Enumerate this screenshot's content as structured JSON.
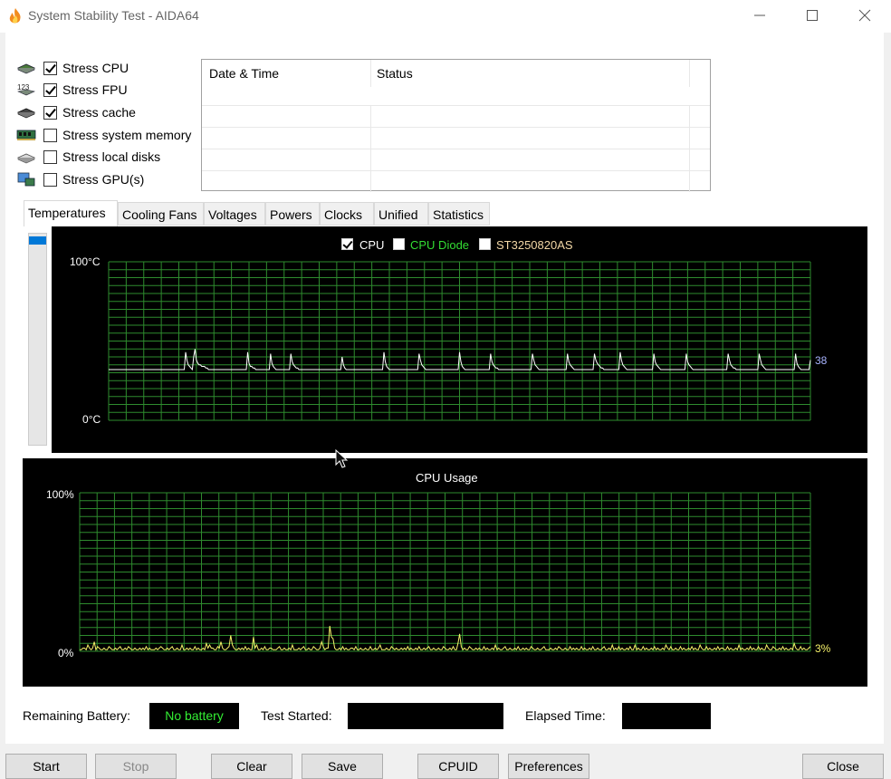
{
  "window": {
    "title": "System Stability Test - AIDA64",
    "controls": {
      "minimize": "—",
      "maximize": "☐",
      "close": "✕"
    }
  },
  "stress_options": [
    {
      "label": "Stress CPU",
      "checked": true,
      "icon": "cpu-chip-icon"
    },
    {
      "label": "Stress FPU",
      "checked": true,
      "icon": "fpu-123-icon"
    },
    {
      "label": "Stress cache",
      "checked": true,
      "icon": "cache-chip-icon"
    },
    {
      "label": "Stress system memory",
      "checked": false,
      "icon": "memory-module-icon"
    },
    {
      "label": "Stress local disks",
      "checked": false,
      "icon": "disk-drive-icon"
    },
    {
      "label": "Stress GPU(s)",
      "checked": false,
      "icon": "gpu-monitor-icon"
    }
  ],
  "log_table": {
    "columns": [
      "Date & Time",
      "Status"
    ],
    "rows": [
      [],
      [],
      [],
      []
    ]
  },
  "tabs": [
    "Temperatures",
    "Cooling Fans",
    "Voltages",
    "Powers",
    "Clocks",
    "Unified",
    "Statistics"
  ],
  "active_tab": "Temperatures",
  "temperature_graph": {
    "legend": [
      {
        "label": "CPU",
        "checked": true,
        "color": "#ffffff"
      },
      {
        "label": "CPU Diode",
        "checked": false,
        "color": "#33dd33"
      },
      {
        "label": "ST3250820AS",
        "checked": false,
        "color": "#f2d7a6"
      }
    ],
    "y_max_label": "100",
    "y_min_label": "0",
    "unit": "°C",
    "current_value": "38",
    "ylim": [
      0,
      100
    ],
    "samples": [
      32,
      32,
      32,
      32,
      32,
      32,
      32,
      32,
      32,
      32,
      32,
      32,
      32,
      32,
      32,
      32,
      32,
      32,
      32,
      32,
      32,
      32,
      32,
      32,
      32,
      32,
      32,
      32,
      32,
      32,
      32,
      32,
      32,
      32,
      32,
      32,
      32,
      32,
      32,
      32,
      32,
      32,
      32,
      32,
      32,
      32,
      32,
      32,
      32,
      32,
      32,
      32,
      32,
      32,
      32,
      32,
      32,
      43,
      38,
      35,
      34,
      33,
      32,
      40,
      45,
      38,
      36,
      35,
      35,
      34,
      34,
      34,
      33,
      33,
      32,
      32,
      32,
      32,
      32,
      32,
      32,
      32,
      32,
      32,
      32,
      32,
      32,
      32,
      32,
      32,
      32,
      32,
      32,
      32,
      32,
      32,
      32,
      32,
      32,
      32,
      32,
      32,
      32,
      43,
      36,
      34,
      34,
      33,
      33,
      32,
      32,
      32,
      32,
      32,
      32,
      32,
      32,
      32,
      32,
      32,
      42,
      36,
      34,
      33,
      32,
      32,
      32,
      32,
      32,
      32,
      32,
      32,
      32,
      32,
      32,
      42,
      37,
      35,
      34,
      33,
      33,
      32,
      32,
      32,
      32,
      32,
      32,
      32,
      32,
      32,
      32,
      32,
      32,
      32,
      32,
      32,
      32,
      32,
      32,
      32,
      32,
      32,
      32,
      32,
      32,
      32,
      32,
      32,
      32,
      32,
      32,
      32,
      32,
      40,
      35,
      33,
      32,
      32,
      32,
      32,
      32,
      32,
      32,
      32,
      32,
      32,
      32,
      32,
      32,
      32,
      32,
      32,
      32,
      32,
      32,
      32,
      32,
      32,
      32,
      32,
      32,
      32,
      32,
      32,
      43,
      37,
      34,
      33,
      32,
      32,
      32,
      32,
      32,
      32,
      32,
      32,
      32,
      32,
      32,
      32,
      32,
      32,
      32,
      32,
      32,
      32,
      32,
      32,
      32,
      32,
      42,
      38,
      35,
      34,
      33,
      32,
      32,
      32,
      32,
      32,
      32,
      32,
      32,
      32,
      32,
      32,
      32,
      32,
      32,
      32,
      32,
      32,
      32,
      32,
      32,
      32,
      32,
      32,
      32,
      32,
      43,
      37,
      34,
      33,
      32,
      32,
      32,
      32,
      32,
      32,
      32,
      32,
      32,
      32,
      32,
      32,
      32,
      32,
      32,
      32,
      32,
      32,
      32,
      42,
      37,
      35,
      34,
      33,
      33,
      32,
      32,
      32,
      32,
      32,
      32,
      32,
      32,
      32,
      32,
      32,
      32,
      32,
      32,
      32,
      32,
      32,
      32,
      32,
      32,
      32,
      32,
      32,
      32,
      32,
      42,
      38,
      35,
      34,
      33,
      32,
      32,
      32,
      32,
      32,
      32,
      32,
      32,
      32,
      32,
      32,
      32,
      32,
      32,
      32,
      32,
      32,
      32,
      32,
      32,
      32,
      42,
      37,
      35,
      34,
      33,
      32,
      32,
      32,
      32,
      32,
      32,
      32,
      32,
      32,
      32,
      32,
      32,
      32,
      32,
      32,
      42,
      38,
      36,
      35,
      34,
      33,
      33,
      32,
      32,
      32,
      32,
      32,
      32,
      32,
      32,
      32,
      32,
      32,
      32,
      43,
      38,
      35,
      34,
      33,
      32,
      32,
      32,
      32,
      32,
      32,
      32,
      32,
      32,
      32,
      32,
      32,
      32,
      32,
      32,
      32,
      32,
      32,
      32,
      32,
      42,
      37,
      35,
      34,
      33,
      32,
      32,
      32,
      32,
      32,
      32,
      32,
      32,
      32,
      32,
      32,
      32,
      32,
      32,
      32,
      32,
      32,
      32,
      32,
      42,
      37,
      35,
      34,
      33,
      32,
      32,
      32,
      32,
      32,
      32,
      32,
      32,
      32,
      32,
      32,
      32,
      32,
      32,
      32,
      32,
      32,
      32,
      32,
      32,
      32,
      32,
      32,
      32,
      32,
      32,
      42,
      38,
      35,
      34,
      33,
      33,
      32,
      32,
      32,
      32,
      32,
      32,
      32,
      32,
      32,
      32,
      32,
      32,
      32,
      32,
      32,
      32,
      32,
      42,
      38,
      35,
      34,
      33,
      32,
      32,
      32,
      32,
      32,
      32,
      32,
      32,
      32,
      32,
      32,
      32,
      32,
      32,
      32,
      32,
      32,
      32,
      32,
      32,
      32,
      32,
      42,
      36,
      34,
      33,
      32,
      32,
      32,
      32,
      32,
      32,
      32,
      38
    ]
  },
  "cpu_usage_graph": {
    "title": "CPU Usage",
    "y_max_label": "100%",
    "y_min_label": "0%",
    "current_value": "3%",
    "ylim": [
      0,
      100
    ],
    "samples": [
      1,
      1,
      2,
      2,
      1,
      4,
      2,
      1,
      2,
      6,
      1,
      3,
      2,
      1,
      1,
      2,
      1,
      1,
      3,
      2,
      1,
      1,
      2,
      1,
      2,
      3,
      1,
      1,
      2,
      1,
      3,
      2,
      1,
      1,
      2,
      1,
      1,
      2,
      1,
      2,
      1,
      3,
      1,
      2,
      1,
      1,
      1,
      2,
      1,
      2,
      3,
      2,
      1,
      1,
      2,
      1,
      2,
      3,
      1,
      1,
      2,
      1,
      1,
      4,
      1,
      1,
      2,
      1,
      2,
      1,
      1,
      3,
      1,
      2,
      1,
      1,
      2,
      1,
      5,
      2,
      4,
      2,
      2,
      1,
      1,
      3,
      2,
      6,
      2,
      1,
      1,
      2,
      3,
      10,
      4,
      2,
      1,
      1,
      2,
      1,
      2,
      1,
      3,
      1,
      2,
      1,
      1,
      9,
      2,
      4,
      1,
      1,
      2,
      1,
      3,
      1,
      1,
      2,
      2,
      1,
      1,
      1,
      2,
      3,
      1,
      1,
      2,
      1,
      1,
      2,
      1,
      4,
      1,
      1,
      1,
      2,
      1,
      2,
      3,
      1,
      1,
      2,
      1,
      1,
      3,
      2,
      1,
      1,
      2,
      6,
      3,
      1,
      2,
      2,
      16,
      9,
      8,
      2,
      1,
      1,
      2,
      1,
      3,
      1,
      2,
      1,
      1,
      2,
      2,
      1,
      3,
      1,
      1,
      2,
      1,
      1,
      2,
      1,
      1,
      3,
      1,
      1,
      2,
      1,
      2,
      4,
      1,
      1,
      1,
      2,
      1,
      1,
      3,
      2,
      1,
      2,
      1,
      1,
      2,
      1,
      2,
      1,
      3,
      1,
      2,
      1,
      1,
      2,
      1,
      3,
      1,
      1,
      2,
      1,
      2,
      3,
      1,
      1,
      2,
      1,
      1,
      2,
      1,
      1,
      3,
      2,
      1,
      1,
      2,
      1,
      3,
      1,
      1,
      5,
      11,
      3,
      1,
      2,
      1,
      1,
      3,
      2,
      1,
      1,
      2,
      1,
      2,
      1,
      1,
      3,
      1,
      2,
      1,
      1,
      2,
      1,
      4,
      1,
      2,
      1,
      1,
      2,
      3,
      1,
      1,
      2,
      1,
      1,
      2,
      1,
      3,
      1,
      1,
      2,
      1,
      2,
      1,
      1,
      3,
      2,
      1,
      1,
      2,
      1,
      1,
      2,
      3,
      1,
      1,
      1,
      2,
      1,
      1,
      2,
      1,
      3,
      2,
      1,
      1,
      2,
      1,
      1,
      3,
      1,
      2,
      1,
      2,
      1,
      1,
      3,
      1,
      2,
      1,
      1,
      2,
      1,
      3,
      1,
      1,
      2,
      1,
      1,
      2,
      3,
      1,
      1,
      2,
      1,
      4,
      1,
      2,
      1,
      3,
      1,
      2,
      1,
      1,
      2,
      1,
      3,
      1,
      1,
      4,
      1,
      2,
      1,
      1,
      3,
      1,
      2,
      1,
      1,
      2,
      1,
      3,
      1,
      2,
      1,
      1,
      2,
      1,
      4,
      2,
      1,
      3,
      1,
      1,
      2,
      1,
      1,
      3,
      1,
      2,
      1,
      1,
      2,
      1,
      3,
      1,
      2,
      1,
      1,
      4,
      2,
      1,
      1,
      3,
      1,
      2,
      1,
      1,
      2,
      1,
      3,
      1,
      2,
      2,
      1,
      1,
      3,
      1,
      2,
      1,
      1,
      2,
      1,
      4,
      1,
      2,
      1,
      1,
      2,
      1,
      3,
      1,
      2,
      1,
      1,
      3,
      1,
      2,
      1,
      1,
      4,
      2,
      1,
      1,
      3,
      2,
      1,
      1,
      2,
      1,
      3,
      1,
      2,
      1,
      1,
      2,
      1,
      5,
      2,
      1,
      1,
      3,
      1,
      2,
      1,
      1,
      2,
      3
    ]
  },
  "status_bar": {
    "battery_label": "Remaining Battery:",
    "battery_value": "No battery",
    "test_started_label": "Test Started:",
    "test_started_value": "",
    "elapsed_label": "Elapsed Time:",
    "elapsed_value": ""
  },
  "buttons": {
    "start": "Start",
    "stop": "Stop",
    "clear": "Clear",
    "save": "Save",
    "cpuid": "CPUID",
    "preferences": "Preferences",
    "close": "Close"
  }
}
